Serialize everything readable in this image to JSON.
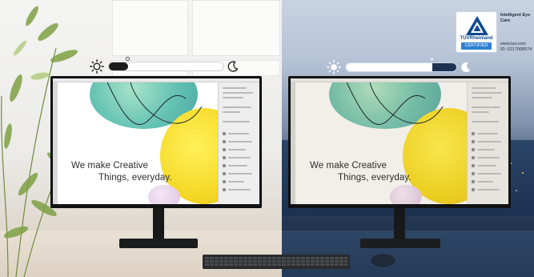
{
  "screen_text": {
    "line1": "We make Creative",
    "line2": "Things, everyday."
  },
  "brightness": {
    "day_level": 0.08,
    "night_level": 0.78
  },
  "badge": {
    "brand": "TÜVRheinland",
    "certified": "CERTIFIED",
    "heading_line1": "Intelligent Eye",
    "heading_line2": "Care",
    "url": "www.tuv.com",
    "id": "ID: 0217008574"
  },
  "colors": {
    "day_accent": "#1c1c1c",
    "night_accent": "#ffffff",
    "tuv_blue": "#0c4a8f",
    "tuv_cert_blue": "#2e7fd0"
  },
  "icons": {
    "day_sun": "sun-icon",
    "day_moon": "moon-icon",
    "night_sun": "sun-icon",
    "night_moon": "moon-icon",
    "tuv": "tuv-triangle-icon"
  }
}
